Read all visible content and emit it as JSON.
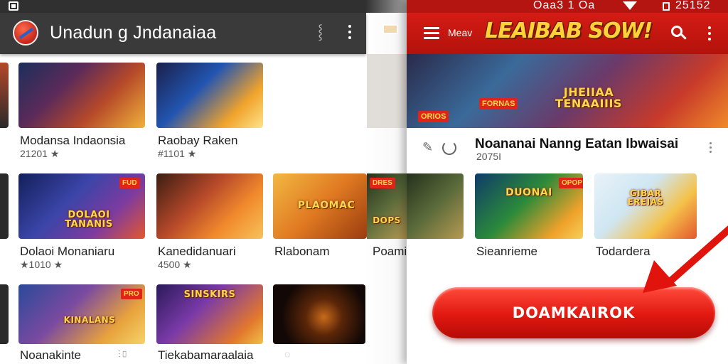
{
  "left_app": {
    "title": "Unadun g Jndanaiaa",
    "items": [
      {
        "title": "Modansa Indaonsia",
        "meta": "21201 ★"
      },
      {
        "title": "Raobay Raken",
        "meta": "#1101 ★"
      },
      {
        "title": "Dolaoi Monaniaru",
        "meta": "★1010 ★"
      },
      {
        "title": "Kanedidanuari",
        "meta": "4500 ★"
      },
      {
        "title": "Rlabonam",
        "meta": ""
      },
      {
        "title": "Poamilks",
        "meta": ""
      },
      {
        "title": "Noanakinte",
        "meta": ""
      },
      {
        "title": "Tiekabamaraalaia",
        "meta": ""
      }
    ],
    "thumb_labels": {
      "item3_banner": "DOLAOI TANANIS",
      "item3_tag": "FUD",
      "item5_banner": "PLAOMAC",
      "item6_tag": "DRES",
      "item6_banner": "DOPS",
      "item7_banner": "KINALANS",
      "item7_tag": "PRO",
      "item8_banner": "SINSKIRS"
    }
  },
  "right_app": {
    "status": {
      "time": "Oaa3 1 Oa",
      "right": "25152"
    },
    "menu_label": "Meav",
    "logo": "LEAIBAB SOW!",
    "hero_banner": "JHEIIAA TENAAIIIS",
    "hero_tag1": "ORIOS",
    "hero_tag2": "FORNAS",
    "hero_title": "Noananai Nanng Eatan Ibwaisai",
    "hero_meta": "2075I",
    "items": [
      {
        "title": "Sieanrieme",
        "banner": "DUONAI",
        "tag": "OPOP"
      },
      {
        "title": "Todardera",
        "banner": "GIBAR EREIAS"
      }
    ],
    "cta_label": "DOAMKAIROK"
  },
  "colors": {
    "accent_red": "#d41c14",
    "logo_yellow": "#ffd23a"
  }
}
